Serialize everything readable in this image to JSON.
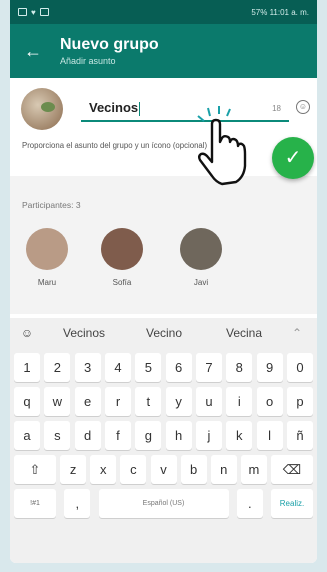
{
  "status": {
    "right": "57% 11:01 a. m."
  },
  "header": {
    "back": "←",
    "title": "Nuevo grupo",
    "subtitle": "Añadir asunto"
  },
  "subject": {
    "value": "Vecinos",
    "count": "18",
    "hint": "Proporciona el asunto del grupo y un ícono (opcional)"
  },
  "fab": {
    "icon": "✓"
  },
  "participants": {
    "title": "Participantes: 3",
    "people": [
      {
        "name": "Maru",
        "color": "#b99b86"
      },
      {
        "name": "Sofía",
        "color": "#7f5c4c"
      },
      {
        "name": "Javi",
        "color": "#6f675c"
      }
    ]
  },
  "keyboard": {
    "suggestions": [
      "Vecinos",
      "Vecino",
      "Vecina"
    ],
    "row1": [
      "1",
      "2",
      "3",
      "4",
      "5",
      "6",
      "7",
      "8",
      "9",
      "0"
    ],
    "row2": [
      "q",
      "w",
      "e",
      "r",
      "t",
      "y",
      "u",
      "i",
      "o",
      "p"
    ],
    "row3": [
      "a",
      "s",
      "d",
      "f",
      "g",
      "h",
      "j",
      "k",
      "l",
      "ñ"
    ],
    "row4": [
      "z",
      "x",
      "c",
      "v",
      "b",
      "n",
      "m"
    ],
    "symbols": "!#1",
    "comma": ",",
    "space": "Español (US)",
    "period": ".",
    "action": "Realiz."
  }
}
